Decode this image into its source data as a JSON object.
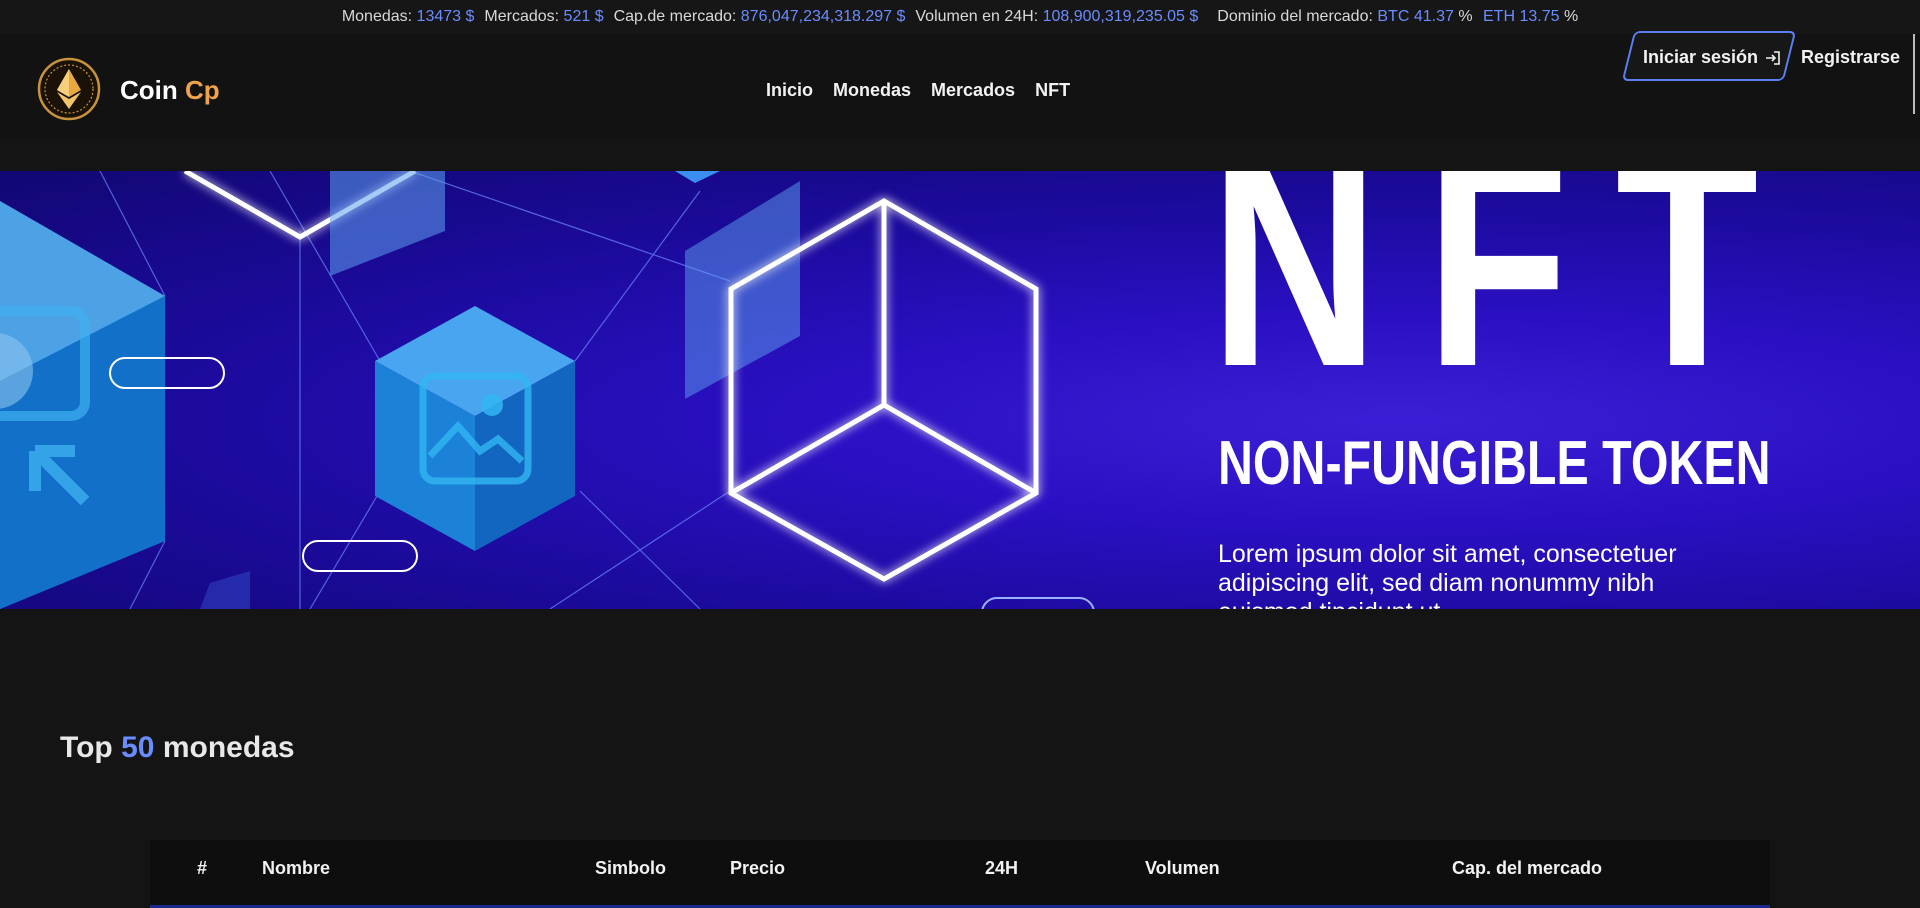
{
  "ticker": {
    "coins_label": "Monedas:",
    "coins_value": "13473 $",
    "markets_label": "Mercados:",
    "markets_value": "521 $",
    "marketcap_label": "Cap.de mercado:",
    "marketcap_value": "876,047,234,318.297 $",
    "volume_label": "Volumen en 24H:",
    "volume_value": "108,900,319,235.05 $",
    "dominance_label": "Dominio del mercado:",
    "btc_value": "BTC 41.37",
    "btc_unit": "%",
    "eth_value": "ETH 13.75",
    "eth_unit": "%"
  },
  "header": {
    "brand_main": "Coin",
    "brand_accent": "Cp",
    "nav": [
      "Inicio",
      "Monedas",
      "Mercados",
      "NFT"
    ],
    "login_label": "Iniciar sesión",
    "register_label": "Registrarse"
  },
  "hero": {
    "big_text": "NFT",
    "subtitle": "NON-FUNGIBLE TOKEN",
    "body": "Lorem ipsum dolor sit amet, consectetuer adipiscing elit, sed diam nonummy nibh euismod tincidunt ut"
  },
  "top_section": {
    "title_pre": "Top",
    "title_num": "50",
    "title_post": "monedas"
  },
  "table": {
    "headers": [
      "#",
      "Nombre",
      "Simbolo",
      "Precio",
      "24H",
      "Volumen",
      "Cap. del mercado"
    ]
  },
  "colors": {
    "accent_blue": "#6b8cff",
    "brand_orange": "#f0a24a",
    "hero_purple": "#2a10c2"
  }
}
